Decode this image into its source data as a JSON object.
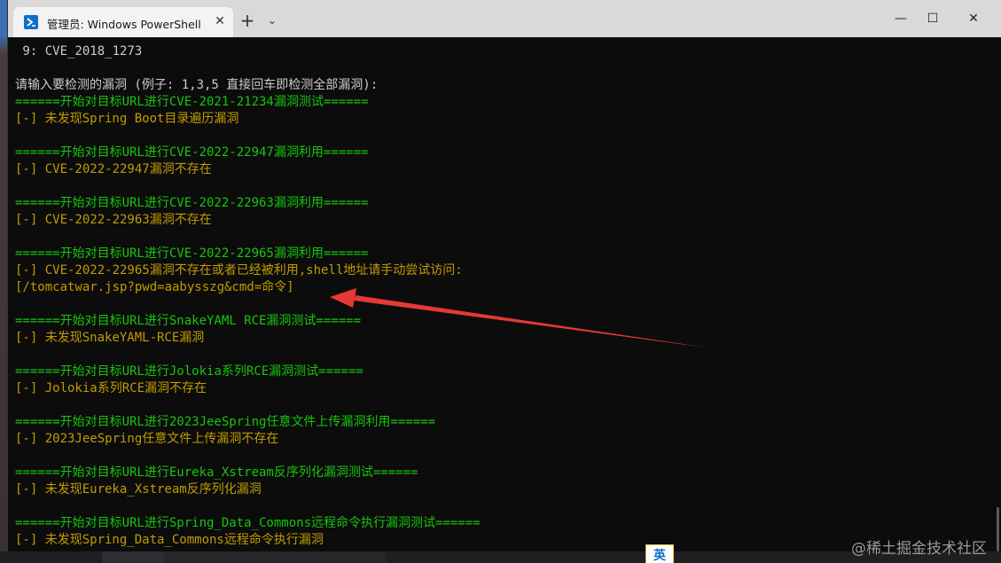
{
  "window": {
    "tab_title": "管理员: Windows PowerShell",
    "close_tab_glyph": "✕",
    "new_tab_glyph": "+",
    "dropdown_glyph": "⌄",
    "minimize_glyph": "—",
    "maximize_glyph": "☐",
    "close_glyph": "✕",
    "icon": "powershell-icon"
  },
  "terminal": {
    "lines": [
      {
        "text": " 9: CVE_2018_1273",
        "color": "white"
      },
      {
        "text": "",
        "color": "white"
      },
      {
        "text": "请输入要检测的漏洞 (例子: 1,3,5 直接回车即检测全部漏洞):",
        "color": "white"
      },
      {
        "text": "======开始对目标URL进行CVE-2021-21234漏洞测试======",
        "color": "green"
      },
      {
        "text": "[-] 未发现Spring Boot目录遍历漏洞",
        "color": "gold"
      },
      {
        "text": "",
        "color": "white"
      },
      {
        "text": "======开始对目标URL进行CVE-2022-22947漏洞利用======",
        "color": "green"
      },
      {
        "text": "[-] CVE-2022-22947漏洞不存在",
        "color": "gold"
      },
      {
        "text": "",
        "color": "white"
      },
      {
        "text": "======开始对目标URL进行CVE-2022-22963漏洞利用======",
        "color": "green"
      },
      {
        "text": "[-] CVE-2022-22963漏洞不存在",
        "color": "gold"
      },
      {
        "text": "",
        "color": "white"
      },
      {
        "text": "======开始对目标URL进行CVE-2022-22965漏洞利用======",
        "color": "green"
      },
      {
        "text": "[-] CVE-2022-22965漏洞不存在或者已经被利用,shell地址请手动尝试访问:",
        "color": "gold"
      },
      {
        "text": "[/tomcatwar.jsp?pwd=aabysszg&cmd=命令]",
        "color": "gold"
      },
      {
        "text": "",
        "color": "white"
      },
      {
        "text": "======开始对目标URL进行SnakeYAML RCE漏洞测试======",
        "color": "green"
      },
      {
        "text": "[-] 未发现SnakeYAML-RCE漏洞",
        "color": "gold"
      },
      {
        "text": "",
        "color": "white"
      },
      {
        "text": "======开始对目标URL进行Jolokia系列RCE漏洞测试======",
        "color": "green"
      },
      {
        "text": "[-] Jolokia系列RCE漏洞不存在",
        "color": "gold"
      },
      {
        "text": "",
        "color": "white"
      },
      {
        "text": "======开始对目标URL进行2023JeeSpring任意文件上传漏洞利用======",
        "color": "green"
      },
      {
        "text": "[-] 2023JeeSpring任意文件上传漏洞不存在",
        "color": "gold"
      },
      {
        "text": "",
        "color": "white"
      },
      {
        "text": "======开始对目标URL进行Eureka_Xstream反序列化漏洞测试======",
        "color": "green"
      },
      {
        "text": "[-] 未发现Eureka_Xstream反序列化漏洞",
        "color": "gold"
      },
      {
        "text": "",
        "color": "white"
      },
      {
        "text": "======开始对目标URL进行Spring_Data_Commons远程命令执行漏洞测试======",
        "color": "green"
      },
      {
        "text": "[-] 未发现Spring_Data_Commons远程命令执行漏洞",
        "color": "gold"
      }
    ]
  },
  "taskbar": {
    "ime_label": "英"
  },
  "watermark": "@稀土掘金技术社区",
  "colors": {
    "white": "#cccccc",
    "green": "#16c60c",
    "gold": "#c19c00",
    "annotation_arrow": "#e53935"
  }
}
